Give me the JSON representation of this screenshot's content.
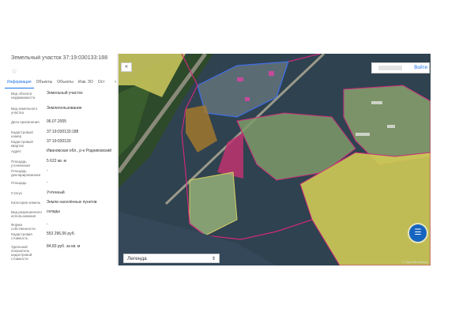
{
  "panel": {
    "title": "Земельный участок 37:19:030133:188",
    "tabs": [
      "Информация",
      "Объекты",
      "Объекты",
      "Изм. ЗО",
      "Ост"
    ],
    "rows": [
      {
        "label": "Вид объекта недвижимости",
        "value": "Земельный участок"
      },
      {
        "label": "Вид земельного участка",
        "value": "Землепользование"
      },
      {
        "label": "Дата присвоения",
        "value": "06.07.2005"
      },
      {
        "label": "Кадастровый номер",
        "value": "37:19:030133:188"
      },
      {
        "label": "Кадастровый квартал",
        "value": "37:19:030133"
      },
      {
        "label": "Адрес",
        "value": "Ивановская обл., р-н Родниковский"
      },
      {
        "label": "Площадь уточненная",
        "value": "5 622 кв. м"
      },
      {
        "label": "Площадь декларированная",
        "value": "-"
      },
      {
        "label": "Площадь",
        "value": "-"
      },
      {
        "label": "Статус",
        "value": "Учтенный"
      },
      {
        "label": "Категория земель",
        "value": "Земли населённых пунктов"
      },
      {
        "label": "Вид разрешенного использования",
        "value": "склады"
      },
      {
        "label": "Форма собственности",
        "value": "-"
      },
      {
        "label": "Кадастровая стоимость",
        "value": "553 296,06 руб."
      },
      {
        "label": "Удельный показатель кадастровой стоимости",
        "value": "84,83 руб. за кв. м"
      }
    ]
  },
  "map": {
    "search_button": "Войти",
    "legend_label": "Легенда",
    "attribution": "© OpenStreetMap"
  },
  "icons": {
    "collapse": "«",
    "star": "☆",
    "chevron": "⇕",
    "layers": "☰",
    "tab_arrow": "›"
  },
  "colors": {
    "parcel_outline": "#cc2a7a",
    "selected_parcel": "#c0336f",
    "yellow_zone": "#d9d060",
    "green_zone": "#9fb77a",
    "fab": "#1565c0"
  }
}
